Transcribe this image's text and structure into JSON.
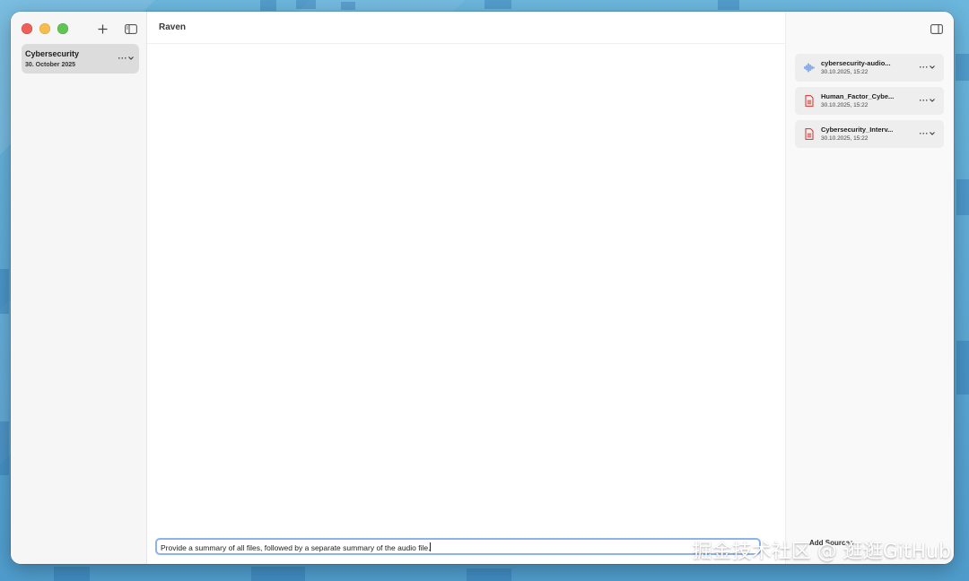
{
  "app": {
    "title": "Raven"
  },
  "sidebar": {
    "chats": [
      {
        "title": "Cybersecurity",
        "date": "30. October 2025",
        "more": "···"
      }
    ]
  },
  "main": {
    "prompt_value": "Provide a summary of all files, followed by a separate summary of the audio file."
  },
  "sources": {
    "files": [
      {
        "name": "cybersecurity-audio...",
        "date": "30.10.2025, 15:22",
        "icon": "audio-waveform-icon",
        "color": "#3f7be0"
      },
      {
        "name": "Human_Factor_Cybe...",
        "date": "30.10.2025, 15:22",
        "icon": "pdf-document-icon",
        "color": "#d0322c"
      },
      {
        "name": "Cybersecurity_Interv...",
        "date": "30.10.2025, 15:22",
        "icon": "pdf-document-icon",
        "color": "#d0322c"
      }
    ],
    "add_label": "Add Sources",
    "more": "···"
  },
  "watermark": "掘金技术社区 @ 逛逛GitHub",
  "colors": {
    "focus_ring": "#8eb2ec",
    "selected_item": "#dcdcdc"
  }
}
